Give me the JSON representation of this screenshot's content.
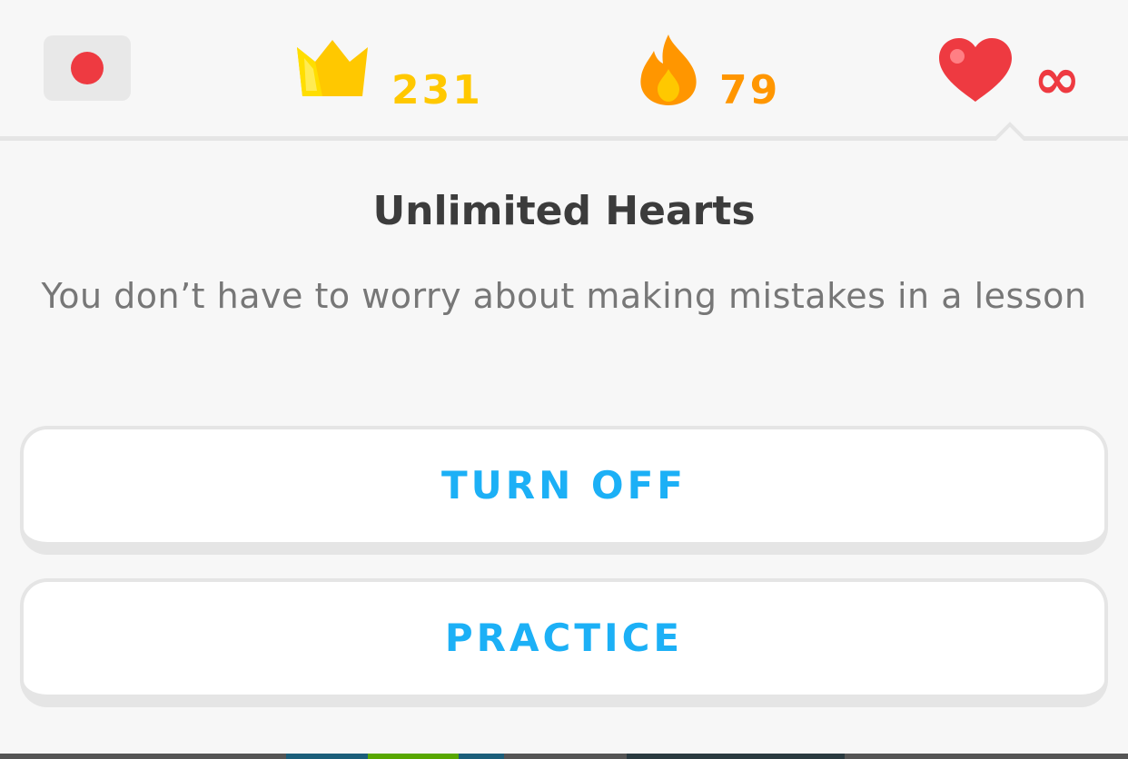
{
  "header": {
    "flag": {
      "icon": "red-circle-flag-icon",
      "color": "#ee3a41"
    },
    "crowns": {
      "icon": "crown-icon",
      "count": "231",
      "color": "#ffc800"
    },
    "streak": {
      "icon": "flame-icon",
      "count": "79",
      "color": "#ff9600"
    },
    "hearts": {
      "icon": "heart-icon",
      "value": "∞",
      "color": "#ee3a41"
    }
  },
  "popup": {
    "title": "Unlimited Hearts",
    "description": "You don’t have to worry about making mistakes in a lesson",
    "buttons": [
      {
        "label": "TURN OFF"
      },
      {
        "label": "PRACTICE"
      }
    ]
  },
  "colors": {
    "accent": "#1cb0f6",
    "title_text": "#3c3c3c",
    "body_text": "#777777",
    "divider": "#e5e5e5"
  }
}
